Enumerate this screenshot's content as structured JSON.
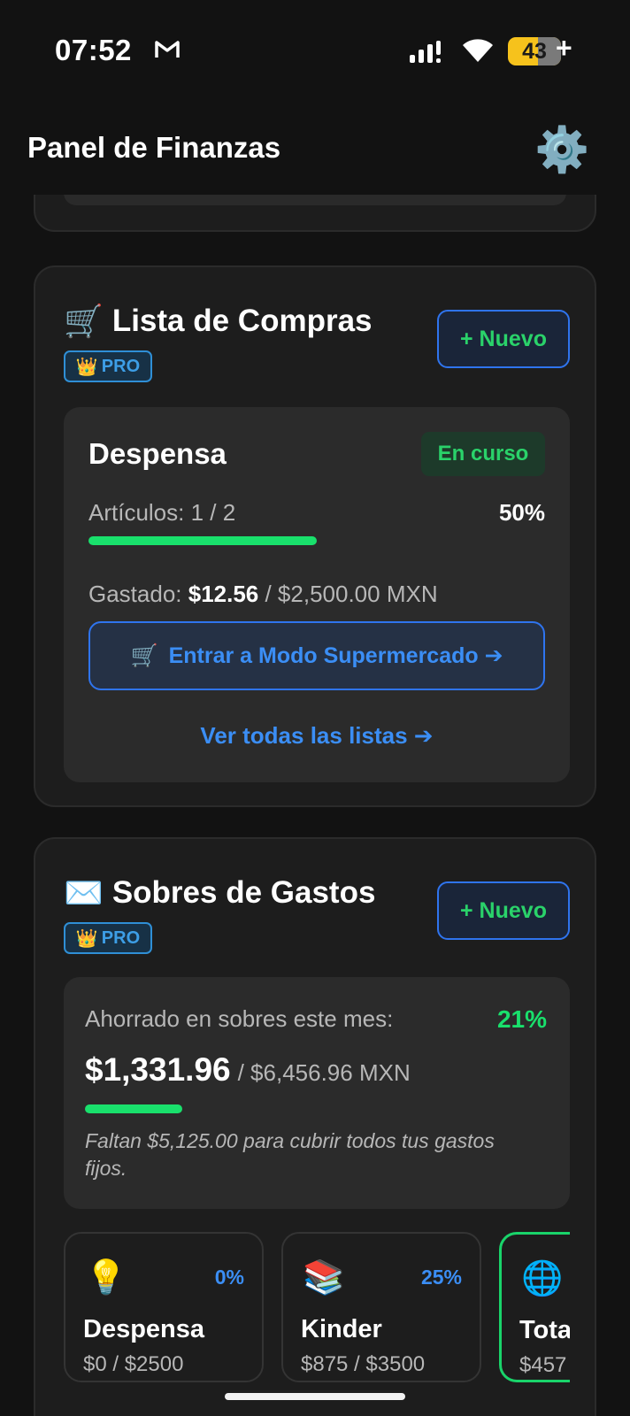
{
  "status_bar": {
    "time": "07:52",
    "battery": "43",
    "battery_plus": "+"
  },
  "header": {
    "title": "Panel de Finanzas",
    "settings_icon": "⚙️"
  },
  "shopping": {
    "icon": "🛒",
    "title": "Lista de Compras",
    "pro_icon": "👑",
    "pro_label": "PRO",
    "new_label": "+ Nuevo",
    "list": {
      "name": "Despensa",
      "status": "En curso",
      "items_label": "Artículos: 1 / 2",
      "progress_label": "50%",
      "progress": 0.5,
      "spent_prefix": "Gastado: ",
      "spent": "$12.56",
      "budget": " / $2,500.00 MXN",
      "button_icon": "🛒",
      "button_label": "Entrar a Modo Supermercado ➔",
      "view_all": "Ver todas las listas ➔"
    }
  },
  "envelopes": {
    "icon": "✉️",
    "title": "Sobres de Gastos",
    "pro_icon": "👑",
    "pro_label": "PRO",
    "new_label": "+ Nuevo",
    "summary": {
      "label": "Ahorrado en sobres este mes:",
      "percent_label": "21%",
      "progress": 0.21,
      "saved": "$1,331.96",
      "total": "/ $6,456.96 MXN",
      "note": "Faltan $5,125.00 para cubrir todos tus gastos fijos."
    },
    "items": [
      {
        "icon": "💡",
        "percent": "0%",
        "name": "Despensa",
        "amount": "$0 / $2500"
      },
      {
        "icon": "📚",
        "percent": "25%",
        "name": "Kinder",
        "amount": "$875 / $3500"
      },
      {
        "icon": "🌐",
        "percent": "",
        "name": "Tota",
        "amount": "$457"
      }
    ]
  },
  "colors": {
    "accent_green": "#19e06c",
    "accent_blue": "#3b8ef5",
    "background": "#121212"
  }
}
